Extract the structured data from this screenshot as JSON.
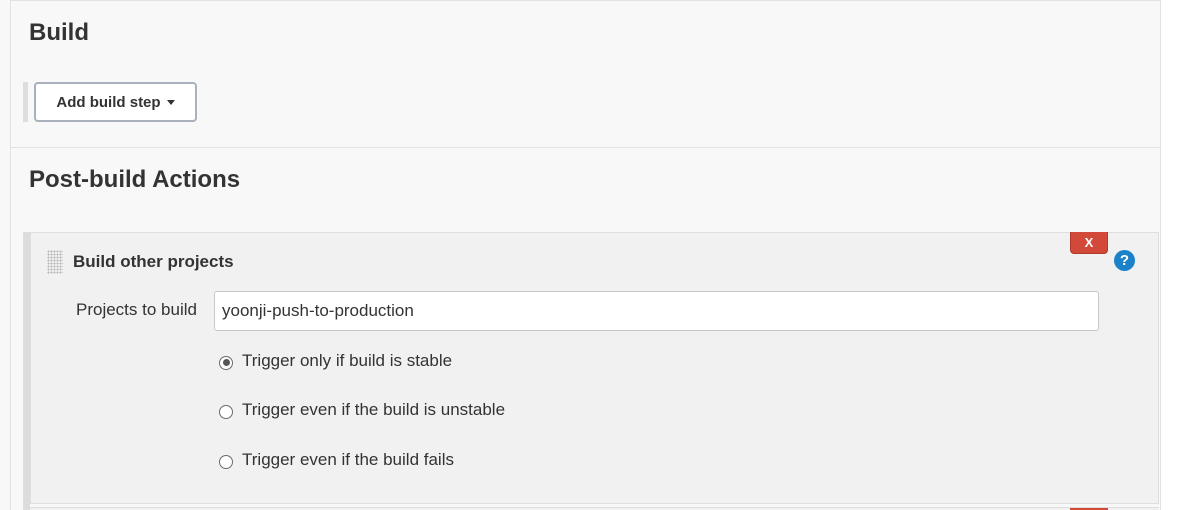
{
  "build": {
    "title": "Build",
    "add_step_label": "Add build step"
  },
  "post_build": {
    "title": "Post-build Actions",
    "action": {
      "title": "Build other projects",
      "delete_label": "X",
      "help_label": "?",
      "projects_label": "Projects to build",
      "projects_value": "yoonji-push-to-production",
      "options": [
        {
          "label": "Trigger only if build is stable",
          "selected": true
        },
        {
          "label": "Trigger even if the build is unstable",
          "selected": false
        },
        {
          "label": "Trigger even if the build fails",
          "selected": false
        }
      ]
    }
  },
  "colors": {
    "delete_button": "#d24939",
    "help_icon": "#1b82c9",
    "panel_background": "#f1f1f1"
  },
  "icons": [
    "chevron-down-icon",
    "drag-handle-icon",
    "close-icon",
    "help-icon"
  ]
}
